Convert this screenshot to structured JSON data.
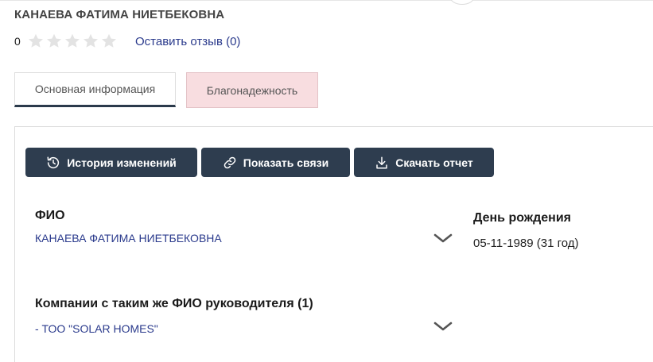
{
  "person": {
    "name_title": "КАНАЕВА ФАТИМА НИЕТБЕКОВНА"
  },
  "rating": {
    "count": "0",
    "stars_filled": 0,
    "stars_total": 5,
    "review_link": "Оставить отзыв (0)"
  },
  "tabs": [
    {
      "label": "Основная информация",
      "active": true
    },
    {
      "label": "Благонадежность",
      "active": false
    }
  ],
  "toolbar": {
    "history_label": "История изменений",
    "links_label": "Показать связи",
    "report_label": "Скачать отчет"
  },
  "fields": {
    "fio": {
      "label": "ФИО",
      "value": "КАНАЕВА ФАТИМА НИЕТБЕКОВНА"
    },
    "birthday": {
      "label": "День рождения",
      "value": "05-11-1989 (31 год)"
    },
    "companies": {
      "label": "Компании с таким же ФИО руководителя (1)",
      "value": "- ТОО \"SOLAR HOMES\""
    }
  },
  "icons": {
    "history": "history-icon",
    "links": "link-icon",
    "report": "download-icon",
    "star": "star-icon",
    "chevron": "chevron-down-icon"
  },
  "colors": {
    "button_bg": "#2e3d4f",
    "link": "#2a3a8c",
    "tab_active_border": "#2b3a4b",
    "reliability_tab_bg": "#f8dde0",
    "star_empty": "#e3e3e3"
  }
}
